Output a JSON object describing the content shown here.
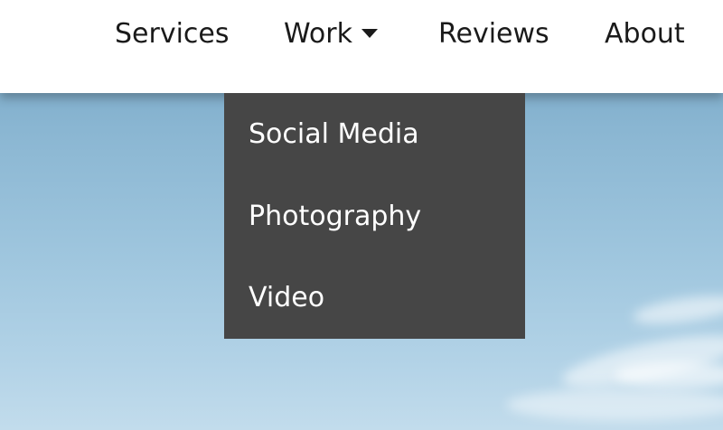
{
  "nav": {
    "items": [
      {
        "label": "Services"
      },
      {
        "label": "Work",
        "icon": "caret-down-icon"
      },
      {
        "label": "Reviews"
      },
      {
        "label": "About"
      }
    ]
  },
  "dropdown": {
    "items": [
      {
        "label": "Social Media"
      },
      {
        "label": "Photography"
      },
      {
        "label": "Video"
      }
    ]
  },
  "colors": {
    "navbar_bg": "#ffffff",
    "nav_text": "#1a1a1a",
    "dropdown_bg": "#464646",
    "dropdown_text": "#ffffff",
    "sky": "#8ab6d2"
  }
}
